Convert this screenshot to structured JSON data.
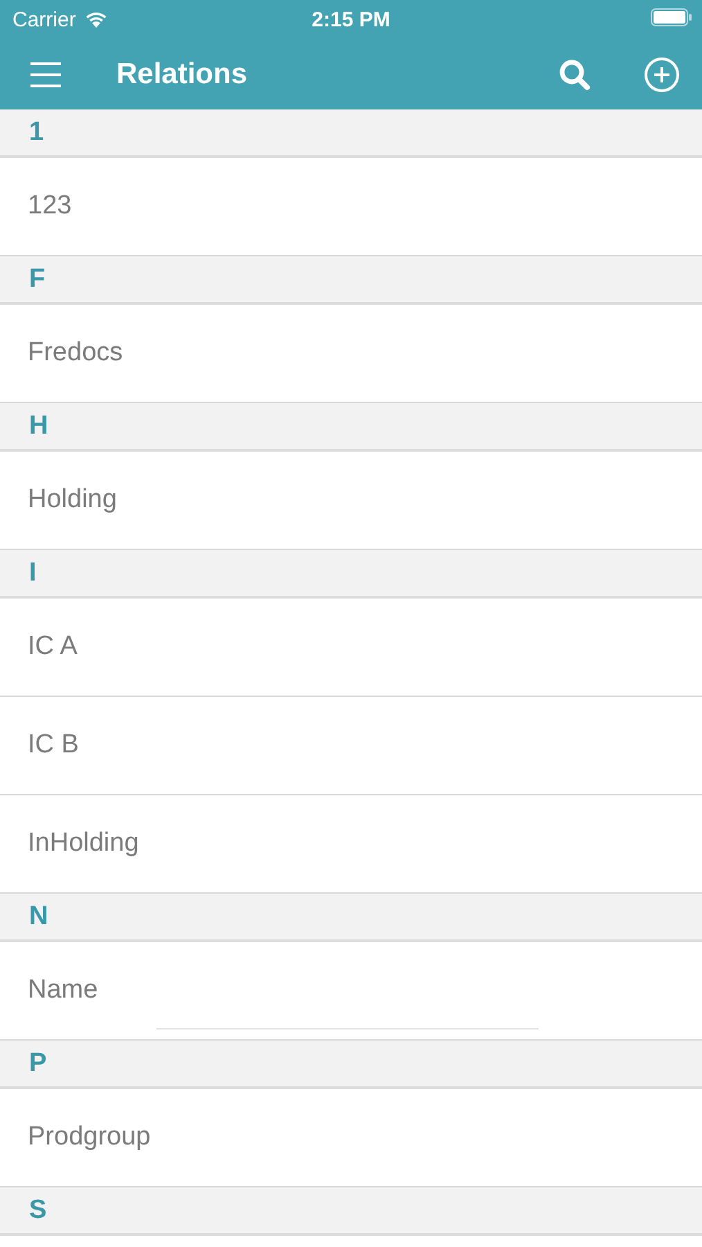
{
  "status_bar": {
    "carrier": "Carrier",
    "time": "2:15 PM"
  },
  "nav": {
    "title": "Relations"
  },
  "sections": [
    {
      "letter": "1",
      "items": [
        {
          "kind": "text",
          "label": "123"
        }
      ]
    },
    {
      "letter": "F",
      "items": [
        {
          "kind": "text",
          "label": "Fredocs"
        }
      ]
    },
    {
      "letter": "H",
      "items": [
        {
          "kind": "text",
          "label": "Holding"
        }
      ]
    },
    {
      "letter": "I",
      "items": [
        {
          "kind": "text",
          "label": "IC A"
        },
        {
          "kind": "text",
          "label": "IC B"
        },
        {
          "kind": "text",
          "label": "InHolding"
        }
      ]
    },
    {
      "letter": "N",
      "items": [
        {
          "kind": "field",
          "label": "Name"
        }
      ]
    },
    {
      "letter": "P",
      "items": [
        {
          "kind": "text",
          "label": "Prodgroup"
        }
      ]
    },
    {
      "letter": "S"
    }
  ]
}
